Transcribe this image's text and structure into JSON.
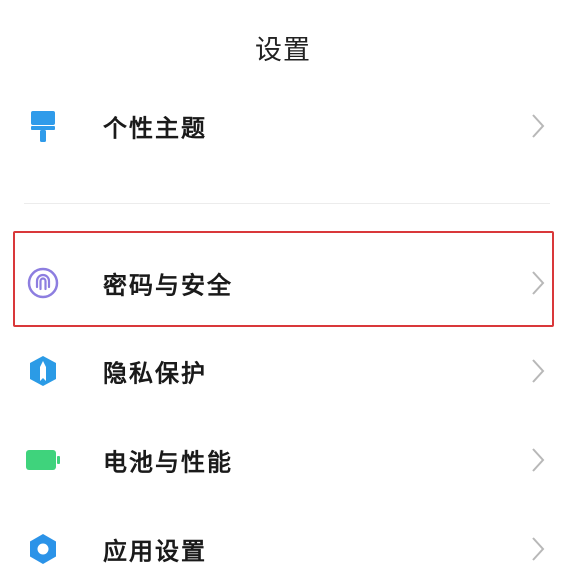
{
  "header": {
    "title": "设置"
  },
  "items": [
    {
      "id": "theme",
      "label": "个性主题",
      "icon": "paint-roller-icon",
      "color": "#2f9bea"
    },
    {
      "id": "security",
      "label": "密码与安全",
      "icon": "fingerprint-icon",
      "color": "#8d7ee0",
      "highlighted": true
    },
    {
      "id": "privacy",
      "label": "隐私保护",
      "icon": "shield-icon",
      "color": "#2b9be6"
    },
    {
      "id": "battery",
      "label": "电池与性能",
      "icon": "battery-icon",
      "color": "#3fd37c"
    },
    {
      "id": "apps",
      "label": "应用设置",
      "icon": "gear-icon",
      "color": "#2b93e8"
    }
  ],
  "colors": {
    "highlight": "#d9383a",
    "chevron": "#b8b8b8"
  }
}
